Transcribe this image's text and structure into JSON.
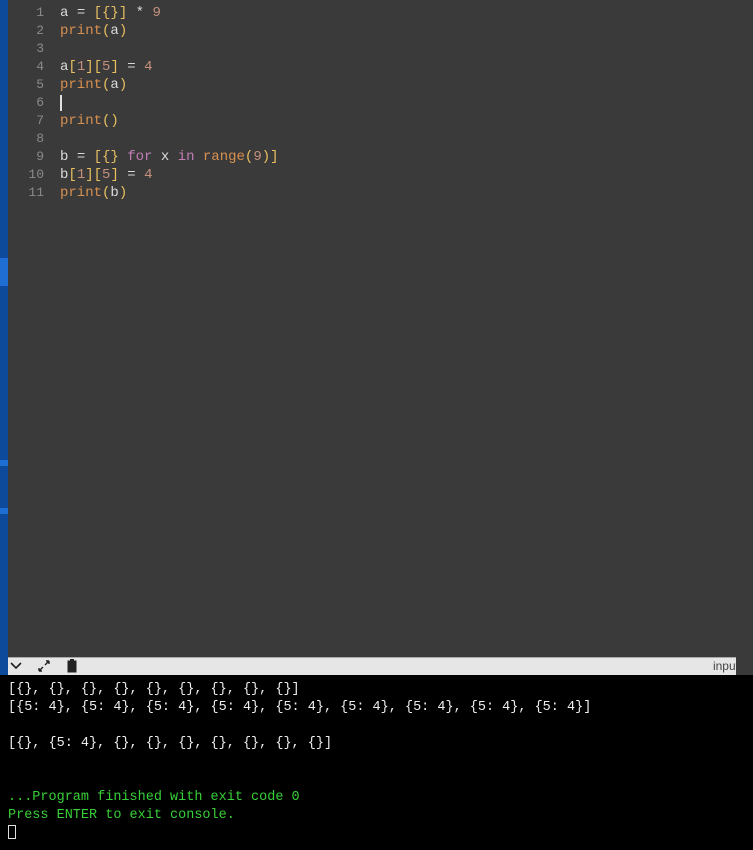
{
  "editor": {
    "cursor_line": 6,
    "lines": [
      [
        {
          "t": "a",
          "c": "tk-var"
        },
        {
          "t": " ",
          "c": "tk-op"
        },
        {
          "t": "=",
          "c": "tk-op"
        },
        {
          "t": " ",
          "c": "tk-op"
        },
        {
          "t": "[{}]",
          "c": "tk-punc"
        },
        {
          "t": " ",
          "c": "tk-op"
        },
        {
          "t": "*",
          "c": "tk-op"
        },
        {
          "t": " ",
          "c": "tk-op"
        },
        {
          "t": "9",
          "c": "tk-num"
        }
      ],
      [
        {
          "t": "print",
          "c": "tk-func"
        },
        {
          "t": "(",
          "c": "tk-punc"
        },
        {
          "t": "a",
          "c": "tk-var"
        },
        {
          "t": ")",
          "c": "tk-punc"
        }
      ],
      [],
      [
        {
          "t": "a",
          "c": "tk-var"
        },
        {
          "t": "[",
          "c": "tk-punc"
        },
        {
          "t": "1",
          "c": "tk-num"
        },
        {
          "t": "][",
          "c": "tk-punc"
        },
        {
          "t": "5",
          "c": "tk-num"
        },
        {
          "t": "]",
          "c": "tk-punc"
        },
        {
          "t": " ",
          "c": "tk-op"
        },
        {
          "t": "=",
          "c": "tk-op"
        },
        {
          "t": " ",
          "c": "tk-op"
        },
        {
          "t": "4",
          "c": "tk-num"
        }
      ],
      [
        {
          "t": "print",
          "c": "tk-func"
        },
        {
          "t": "(",
          "c": "tk-punc"
        },
        {
          "t": "a",
          "c": "tk-var"
        },
        {
          "t": ")",
          "c": "tk-punc"
        }
      ],
      [],
      [
        {
          "t": "print",
          "c": "tk-func"
        },
        {
          "t": "()",
          "c": "tk-punc"
        }
      ],
      [],
      [
        {
          "t": "b",
          "c": "tk-var"
        },
        {
          "t": " ",
          "c": "tk-op"
        },
        {
          "t": "=",
          "c": "tk-op"
        },
        {
          "t": " ",
          "c": "tk-op"
        },
        {
          "t": "[{}",
          "c": "tk-punc"
        },
        {
          "t": " ",
          "c": "tk-op"
        },
        {
          "t": "for",
          "c": "tk-kw"
        },
        {
          "t": " ",
          "c": "tk-op"
        },
        {
          "t": "x",
          "c": "tk-var"
        },
        {
          "t": " ",
          "c": "tk-op"
        },
        {
          "t": "in",
          "c": "tk-kw"
        },
        {
          "t": " ",
          "c": "tk-op"
        },
        {
          "t": "range",
          "c": "tk-func"
        },
        {
          "t": "(",
          "c": "tk-punc"
        },
        {
          "t": "9",
          "c": "tk-num"
        },
        {
          "t": ")]",
          "c": "tk-punc"
        }
      ],
      [
        {
          "t": "b",
          "c": "tk-var"
        },
        {
          "t": "[",
          "c": "tk-punc"
        },
        {
          "t": "1",
          "c": "tk-num"
        },
        {
          "t": "][",
          "c": "tk-punc"
        },
        {
          "t": "5",
          "c": "tk-num"
        },
        {
          "t": "]",
          "c": "tk-punc"
        },
        {
          "t": " ",
          "c": "tk-op"
        },
        {
          "t": "=",
          "c": "tk-op"
        },
        {
          "t": " ",
          "c": "tk-op"
        },
        {
          "t": "4",
          "c": "tk-num"
        }
      ],
      [
        {
          "t": "print",
          "c": "tk-func"
        },
        {
          "t": "(",
          "c": "tk-punc"
        },
        {
          "t": "b",
          "c": "tk-var"
        },
        {
          "t": ")",
          "c": "tk-punc"
        }
      ]
    ]
  },
  "toolbar": {
    "input_label": "input"
  },
  "console": {
    "line1": "[{}, {}, {}, {}, {}, {}, {}, {}, {}]",
    "line2": "[{5: 4}, {5: 4}, {5: 4}, {5: 4}, {5: 4}, {5: 4}, {5: 4}, {5: 4}, {5: 4}]",
    "blank": "",
    "line3": "[{}, {5: 4}, {}, {}, {}, {}, {}, {}, {}]",
    "finished": "...Program finished with exit code 0",
    "prompt": "Press ENTER to exit console."
  }
}
